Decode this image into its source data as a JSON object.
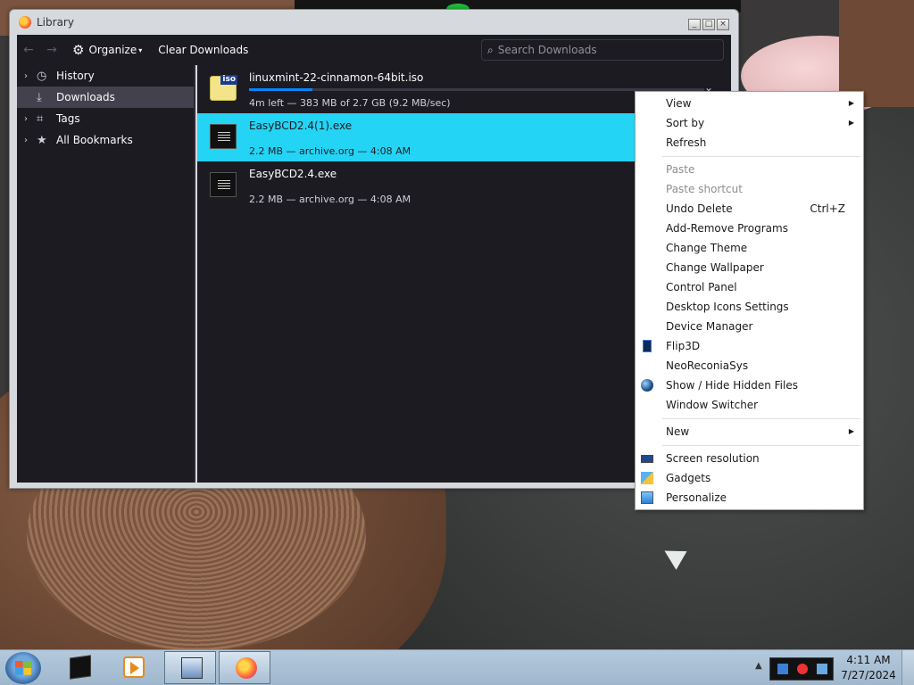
{
  "window": {
    "title": "Library",
    "controls": [
      "_",
      "□",
      "×"
    ]
  },
  "toolbar": {
    "back_icon": "←",
    "forward_icon": "→",
    "organize_label": "Organize",
    "clear_downloads_label": "Clear Downloads",
    "search_placeholder": "Search Downloads"
  },
  "sidebar": {
    "items": [
      {
        "label": "History",
        "icon": "clock-icon",
        "glyph": "◷"
      },
      {
        "label": "Downloads",
        "icon": "download-icon",
        "glyph": "⤓",
        "selected": true
      },
      {
        "label": "Tags",
        "icon": "tag-icon",
        "glyph": "⌗"
      },
      {
        "label": "All Bookmarks",
        "icon": "star-icon",
        "glyph": "★"
      }
    ]
  },
  "downloads": [
    {
      "name": "linuxmint-22-cinnamon-64bit.iso",
      "status": "4m left — 383 MB of 2.7 GB (9.2 MB/sec)",
      "icon_badge": "iso",
      "progress": 0.14
    },
    {
      "name": "EasyBCD2.4(1).exe",
      "status": "2.2 MB — archive.org — 4:08 AM",
      "selected": true
    },
    {
      "name": "EasyBCD2.4.exe",
      "status": "2.2 MB — archive.org — 4:08 AM"
    }
  ],
  "context_menu": {
    "items": [
      {
        "label": "View",
        "submenu": true
      },
      {
        "label": "Sort by",
        "submenu": true
      },
      {
        "label": "Refresh"
      },
      {
        "label": "Paste",
        "disabled": true
      },
      {
        "label": "Paste shortcut",
        "disabled": true
      },
      {
        "label": "Undo Delete",
        "shortcut": "Ctrl+Z"
      },
      {
        "label": "Add-Remove Programs"
      },
      {
        "label": "Change Theme"
      },
      {
        "label": "Change Wallpaper"
      },
      {
        "label": "Control Panel"
      },
      {
        "label": "Desktop Icons Settings"
      },
      {
        "label": "Device Manager"
      },
      {
        "label": "Flip3D",
        "icon": "flip3d-icon"
      },
      {
        "label": "NeoReconiaSys"
      },
      {
        "label": "Show / Hide Hidden Files",
        "icon": "globe-icon"
      },
      {
        "label": "Window Switcher"
      },
      {
        "label": "New",
        "submenu": true
      },
      {
        "label": "Screen resolution",
        "icon": "screen-resolution-icon"
      },
      {
        "label": "Gadgets",
        "icon": "gadgets-icon"
      },
      {
        "label": "Personalize",
        "icon": "personalize-icon"
      }
    ]
  },
  "taskbar": {
    "clock_time": "4:11 AM",
    "clock_date": "7/27/2024",
    "tray_expand": "▲"
  }
}
